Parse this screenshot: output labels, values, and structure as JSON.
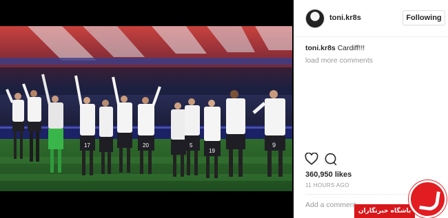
{
  "post": {
    "username": "toni.kr8s",
    "follow_label": "Following",
    "caption_user": "toni.kr8s",
    "caption_text": "Cardiff!!!",
    "load_more": "load more comments",
    "likes": "360,950 likes",
    "time": "11 HOURS AGO",
    "comment_placeholder": "Add a comment..."
  },
  "photo": {
    "jersey_numbers": [
      "17",
      "20",
      "5",
      "19",
      "9"
    ]
  },
  "watermark": {
    "text": "باشگاه خبرنگاران",
    "color": "#e21d22"
  },
  "icons": {
    "like": "heart-icon",
    "comment": "comment-icon",
    "avatar": "avatar-icon"
  }
}
